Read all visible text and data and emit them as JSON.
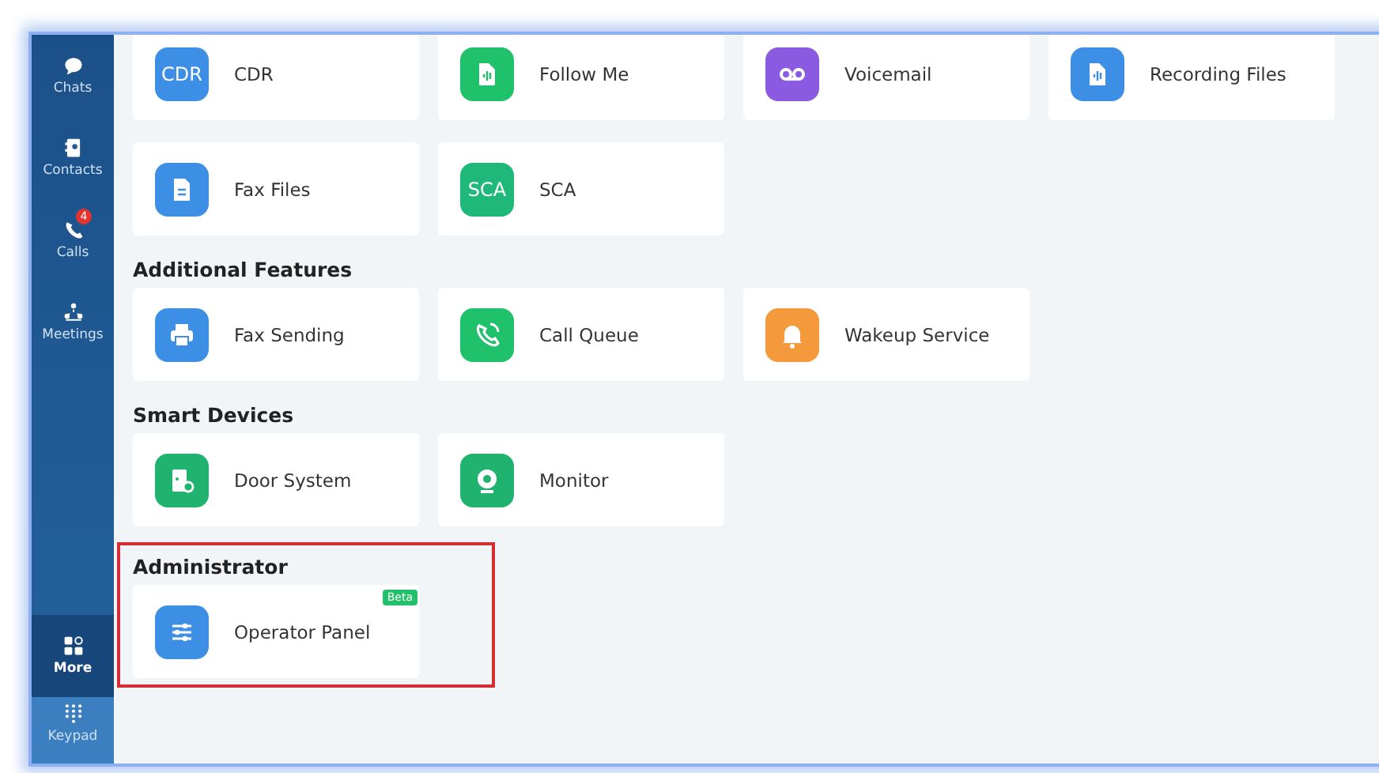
{
  "sidebar": {
    "items": [
      {
        "label": "Chats",
        "selected": false
      },
      {
        "label": "Contacts",
        "selected": false
      },
      {
        "label": "Calls",
        "selected": false,
        "badge": "4"
      },
      {
        "label": "Meetings",
        "selected": false
      },
      {
        "label": "More",
        "selected": true
      },
      {
        "label": "Keypad",
        "selected": false
      }
    ]
  },
  "sections": [
    {
      "items": [
        {
          "label": "CDR",
          "color": "#3d8fe6",
          "icon_text": "CDR"
        },
        {
          "label": "Follow Me",
          "color": "#1fc16b"
        },
        {
          "label": "Voicemail",
          "color": "#8a5ae0"
        },
        {
          "label": "Recording Files",
          "color": "#3d8fe6"
        },
        {
          "label": "Fax Files",
          "color": "#3d8fe6"
        },
        {
          "label": "SCA",
          "color": "#1fb87a",
          "icon_text": "SCA"
        }
      ]
    },
    {
      "title": "Additional Features",
      "items": [
        {
          "label": "Fax Sending",
          "color": "#3d8fe6"
        },
        {
          "label": "Call Queue",
          "color": "#1fc16b"
        },
        {
          "label": "Wakeup Service",
          "color": "#f59a3c"
        }
      ]
    },
    {
      "title": "Smart Devices",
      "items": [
        {
          "label": "Door System",
          "color": "#1fb36f"
        },
        {
          "label": "Monitor",
          "color": "#1fb36f"
        }
      ]
    },
    {
      "title": "Administrator",
      "highlighted": true,
      "items": [
        {
          "label": "Operator Panel",
          "color": "#3d8fe6",
          "badge": "Beta"
        }
      ]
    }
  ]
}
